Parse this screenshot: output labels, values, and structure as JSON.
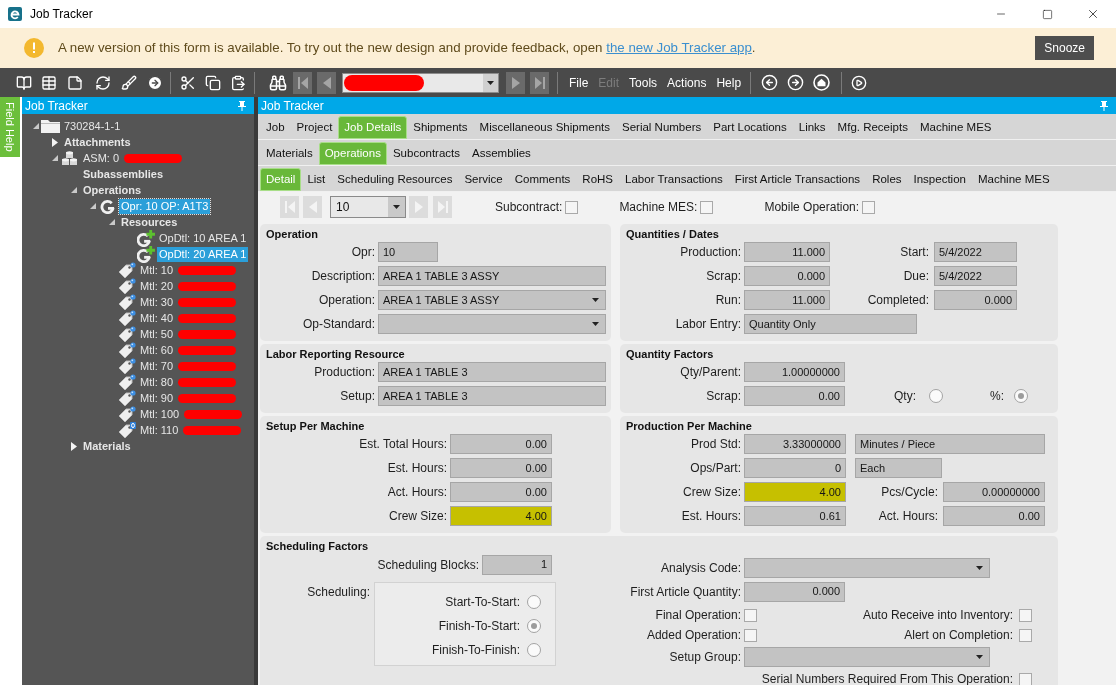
{
  "window": {
    "title": "Job Tracker"
  },
  "banner": {
    "message": "A new version of this form is available. To try out the new design and provide feedback, open ",
    "link": "the new Job Tracker app",
    "message_end": ".",
    "button": "Snooze"
  },
  "toolbar": {
    "record_field": {
      "redacted": true
    },
    "menus": [
      {
        "label": "File",
        "disabled": false
      },
      {
        "label": "Edit",
        "disabled": true
      },
      {
        "label": "Tools",
        "disabled": false
      },
      {
        "label": "Actions",
        "disabled": false
      },
      {
        "label": "Help",
        "disabled": false
      }
    ]
  },
  "field_help": {
    "label": "Field Help"
  },
  "tree_panel": {
    "title": "Job Tracker",
    "items": [
      {
        "label": "730284-1-1",
        "kind": "job",
        "expanded": true,
        "selected": false,
        "children": [
          {
            "label": "Attachments",
            "kind": "group",
            "expanded": false,
            "selected": false
          },
          {
            "label": "ASM: 0",
            "kind": "assembly",
            "expanded": true,
            "selected": false,
            "redacted": true,
            "children": [
              {
                "label": "Subassemblies",
                "kind": "group",
                "selected": false
              },
              {
                "label": "Operations",
                "kind": "group",
                "expanded": true,
                "selected": false,
                "children": [
                  {
                    "label": "Opr: 10 OP: A1T3",
                    "kind": "operation",
                    "expanded": true,
                    "selected": true,
                    "focused": true,
                    "children": [
                      {
                        "label": "Resources",
                        "kind": "group",
                        "expanded": true,
                        "selected": false,
                        "children": [
                          {
                            "label": "OpDtl: 10 AREA 1",
                            "kind": "resource",
                            "selected": false
                          },
                          {
                            "label": "OpDtl: 20 AREA 1",
                            "kind": "resource",
                            "selected": true
                          }
                        ]
                      },
                      {
                        "label": "Mtl: 10",
                        "kind": "material",
                        "selected": false,
                        "redacted": true
                      },
                      {
                        "label": "Mtl: 20",
                        "kind": "material",
                        "selected": false,
                        "redacted": true
                      },
                      {
                        "label": "Mtl: 30",
                        "kind": "material",
                        "selected": false,
                        "redacted": true
                      },
                      {
                        "label": "Mtl: 40",
                        "kind": "material",
                        "selected": false,
                        "redacted": true
                      },
                      {
                        "label": "Mtl: 50",
                        "kind": "material",
                        "selected": false,
                        "redacted": true
                      },
                      {
                        "label": "Mtl: 60",
                        "kind": "material",
                        "selected": false,
                        "redacted": true
                      },
                      {
                        "label": "Mtl: 70",
                        "kind": "material",
                        "selected": false,
                        "redacted": true
                      },
                      {
                        "label": "Mtl: 80",
                        "kind": "material",
                        "selected": false,
                        "redacted": true
                      },
                      {
                        "label": "Mtl: 90",
                        "kind": "material",
                        "selected": false,
                        "redacted": true
                      },
                      {
                        "label": "Mtl: 100",
                        "kind": "material",
                        "selected": false,
                        "redacted": true
                      },
                      {
                        "label": "Mtl: 110",
                        "kind": "material_badge",
                        "selected": false,
                        "redacted": true
                      }
                    ]
                  }
                ]
              },
              {
                "label": "Materials",
                "kind": "group",
                "expanded": false,
                "selected": false
              }
            ]
          }
        ]
      }
    ]
  },
  "main": {
    "title": "Job Tracker",
    "tab_rows": [
      {
        "tabs": [
          {
            "label": "Job",
            "selected": false
          },
          {
            "label": "Project",
            "selected": false
          },
          {
            "label": "Job Details",
            "selected": true
          },
          {
            "label": "Shipments",
            "selected": false
          },
          {
            "label": "Miscellaneous Shipments",
            "selected": false
          },
          {
            "label": "Serial Numbers",
            "selected": false
          },
          {
            "label": "Part Locations",
            "selected": false
          },
          {
            "label": "Links",
            "selected": false
          },
          {
            "label": "Mfg. Receipts",
            "selected": false
          },
          {
            "label": "Machine MES",
            "selected": false
          }
        ]
      },
      {
        "tabs": [
          {
            "label": "Materials",
            "selected": false
          },
          {
            "label": "Operations",
            "selected": true
          },
          {
            "label": "Subcontracts",
            "selected": false
          },
          {
            "label": "Assemblies",
            "selected": false
          }
        ]
      },
      {
        "tabs": [
          {
            "label": "Detail",
            "selected": true
          },
          {
            "label": "List",
            "selected": false
          },
          {
            "label": "Scheduling Resources",
            "selected": false
          },
          {
            "label": "Service",
            "selected": false
          },
          {
            "label": "Comments",
            "selected": false
          },
          {
            "label": "RoHS",
            "selected": false
          },
          {
            "label": "Labor Transactions",
            "selected": false
          },
          {
            "label": "First Article Transactions",
            "selected": false
          },
          {
            "label": "Roles",
            "selected": false
          },
          {
            "label": "Inspection",
            "selected": false
          },
          {
            "label": "Machine MES",
            "selected": false
          }
        ]
      }
    ],
    "nav": {
      "value": "10",
      "options": [
        {
          "label": "Subcontract:",
          "checked": false
        },
        {
          "label": "Machine MES:",
          "checked": false
        },
        {
          "label": "Mobile Operation:",
          "checked": false
        }
      ]
    },
    "operation": {
      "title": "Operation",
      "opr": {
        "label": "Opr:",
        "value": "10"
      },
      "description": {
        "label": "Description:",
        "value": "AREA 1 TABLE 3 ASSY"
      },
      "operation": {
        "label": "Operation:",
        "value": "AREA 1 TABLE 3 ASSY"
      },
      "op_standard": {
        "label": "Op-Standard:"
      }
    },
    "quantities_dates": {
      "title": "Quantities / Dates",
      "production": {
        "label": "Production:",
        "value": "11.000"
      },
      "start": {
        "label": "Start:",
        "value": "5/4/2022"
      },
      "scrap": {
        "label": "Scrap:",
        "value": "0.000"
      },
      "due": {
        "label": "Due:",
        "value": "5/4/2022"
      },
      "run": {
        "label": "Run:",
        "value": "11.000"
      },
      "completed": {
        "label": "Completed:",
        "value": "0.000"
      },
      "labor_entry": {
        "label": "Labor Entry:",
        "value": "Quantity Only"
      }
    },
    "labor_reporting": {
      "title": "Labor Reporting Resource",
      "production": {
        "label": "Production:",
        "value": "AREA 1 TABLE 3"
      },
      "setup": {
        "label": "Setup:",
        "value": "AREA 1 TABLE 3"
      }
    },
    "quantity_factors": {
      "title": "Quantity Factors",
      "qty_parent": {
        "label": "Qty/Parent:",
        "value": "1.00000000"
      },
      "scrap": {
        "label": "Scrap:",
        "value": "0.00"
      },
      "scrap_basis": [
        {
          "label": "Qty:",
          "selected": false
        },
        {
          "label": "%:",
          "selected": true
        }
      ]
    },
    "setup_per_machine": {
      "title": "Setup Per Machine",
      "fields": [
        {
          "label": "Est. Total Hours:",
          "value": "0.00",
          "highlighted": false
        },
        {
          "label": "Est. Hours:",
          "value": "0.00",
          "highlighted": false
        },
        {
          "label": "Act. Hours:",
          "value": "0.00",
          "highlighted": false
        },
        {
          "label": "Crew Size:",
          "value": "4.00",
          "highlighted": true
        }
      ]
    },
    "production_per_machine": {
      "title": "Production Per Machine",
      "prod_std": {
        "label": "Prod Std:",
        "value": "3.33000000",
        "unit": "Minutes / Piece"
      },
      "ops_part": {
        "label": "Ops/Part:",
        "value": "0",
        "unit": "Each"
      },
      "crew_size": {
        "label": "Crew Size:",
        "value": "4.00",
        "highlighted": true
      },
      "pcs_cycle": {
        "label": "Pcs/Cycle:",
        "value": "0.00000000"
      },
      "est_hours": {
        "label": "Est. Hours:",
        "value": "0.61"
      },
      "act_hours": {
        "label": "Act. Hours:",
        "value": "0.00"
      }
    },
    "scheduling_factors": {
      "title": "Scheduling Factors",
      "scheduling_blocks": {
        "label": "Scheduling Blocks:",
        "value": "1"
      },
      "scheduling": {
        "label": "Scheduling:",
        "options": [
          {
            "label": "Start-To-Start:",
            "selected": false
          },
          {
            "label": "Finish-To-Start:",
            "selected": true
          },
          {
            "label": "Finish-To-Finish:",
            "selected": false
          }
        ]
      },
      "analysis_code": {
        "label": "Analysis Code:"
      },
      "first_article_quantity": {
        "label": "First Article Quantity:",
        "value": "0.000"
      },
      "final_operation": {
        "label": "Final Operation:",
        "checked": false
      },
      "auto_receive": {
        "label": "Auto Receive into Inventory:",
        "checked": false
      },
      "added_operation": {
        "label": "Added Operation:",
        "checked": false
      },
      "alert_on_completion": {
        "label": "Alert on Completion:",
        "checked": false
      },
      "setup_group": {
        "label": "Setup Group:"
      },
      "serial_numbers_required": {
        "label": "Serial Numbers Required From This Operation:",
        "checked": false
      }
    }
  }
}
